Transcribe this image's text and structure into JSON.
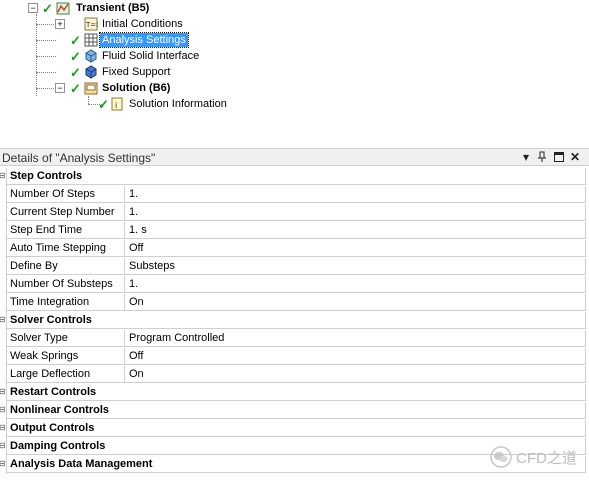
{
  "tree": {
    "transient": "Transient (B5)",
    "initial_conditions": "Initial Conditions",
    "analysis_settings": "Analysis Settings",
    "fluid_solid_interface": "Fluid Solid Interface",
    "fixed_support": "Fixed Support",
    "solution": "Solution (B6)",
    "solution_information": "Solution Information",
    "selected_color": "#3399ff",
    "check_color": "#1aa01a"
  },
  "details": {
    "title": "Details of \"Analysis Settings\"",
    "header_icons": [
      "dropdown-icon",
      "pin-icon",
      "maximize-icon",
      "close-icon"
    ],
    "sections": [
      {
        "name": "Step Controls",
        "props": [
          {
            "name": "Number Of Steps",
            "value": "1."
          },
          {
            "name": "Current Step Number",
            "value": "1."
          },
          {
            "name": "Step End Time",
            "value": "1. s"
          },
          {
            "name": "Auto Time Stepping",
            "value": "Off"
          },
          {
            "name": "Define By",
            "value": "Substeps"
          },
          {
            "name": "Number Of Substeps",
            "value": "1."
          },
          {
            "name": "Time Integration",
            "value": "On"
          }
        ]
      },
      {
        "name": "Solver Controls",
        "props": [
          {
            "name": "Solver Type",
            "value": "Program Controlled"
          },
          {
            "name": "Weak Springs",
            "value": "Off"
          },
          {
            "name": "Large Deflection",
            "value": "On"
          }
        ]
      },
      {
        "name": "Restart Controls",
        "props": []
      },
      {
        "name": "Nonlinear Controls",
        "props": []
      },
      {
        "name": "Output Controls",
        "props": []
      },
      {
        "name": "Damping Controls",
        "props": []
      },
      {
        "name": "Analysis Data Management",
        "props": []
      }
    ]
  },
  "watermark": {
    "text": "CFD之道"
  }
}
